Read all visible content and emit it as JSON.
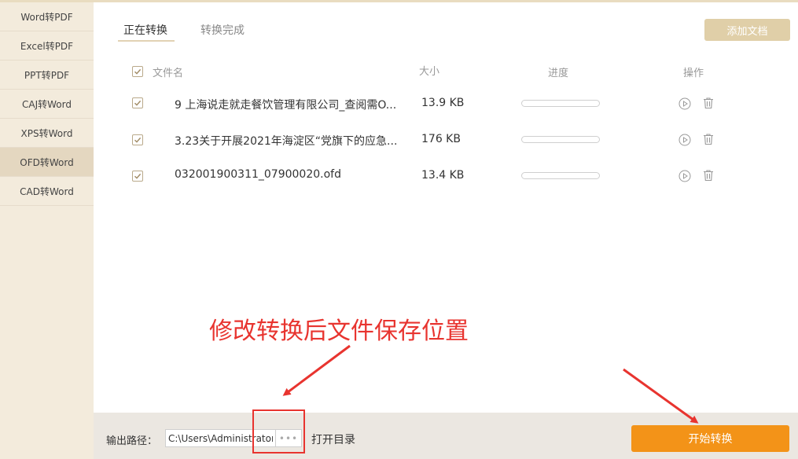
{
  "sidebar": {
    "items": [
      {
        "label": "Word转PDF"
      },
      {
        "label": "Excel转PDF"
      },
      {
        "label": "PPT转PDF"
      },
      {
        "label": "CAJ转Word"
      },
      {
        "label": "XPS转Word"
      },
      {
        "label": "OFD转Word",
        "active": true
      },
      {
        "label": "CAD转Word"
      }
    ]
  },
  "tabs": [
    {
      "label": "正在转换",
      "active": true
    },
    {
      "label": "转换完成",
      "active": false
    }
  ],
  "add_button_label": "添加文档",
  "table": {
    "headers": {
      "name": "文件名",
      "size": "大小",
      "progress": "进度",
      "actions": "操作"
    },
    "rows": [
      {
        "checked": true,
        "name": "9 上海说走就走餐饮管理有限公司_查阅需O...",
        "size": "13.9 KB",
        "progress": 0
      },
      {
        "checked": true,
        "name": "3.23关于开展2021年海淀区“党旗下的应急...",
        "size": "176 KB",
        "progress": 0
      },
      {
        "checked": true,
        "name": "032001900311_07900020.ofd",
        "size": "13.4 KB",
        "progress": 0
      }
    ]
  },
  "annotation_text": "修改转换后文件保存位置",
  "footer": {
    "output_label": "输出路径：",
    "output_path": "C:\\Users\\Administrator",
    "browse_label": "•••",
    "open_dir_label": "打开目录",
    "start_label": "开始转换"
  },
  "colors": {
    "accent": "#f39318",
    "annotation": "#e8342f",
    "add_button": "#e0cfa8"
  },
  "icons": {
    "check": "check-icon",
    "play": "play-icon",
    "trash": "trash-icon"
  }
}
